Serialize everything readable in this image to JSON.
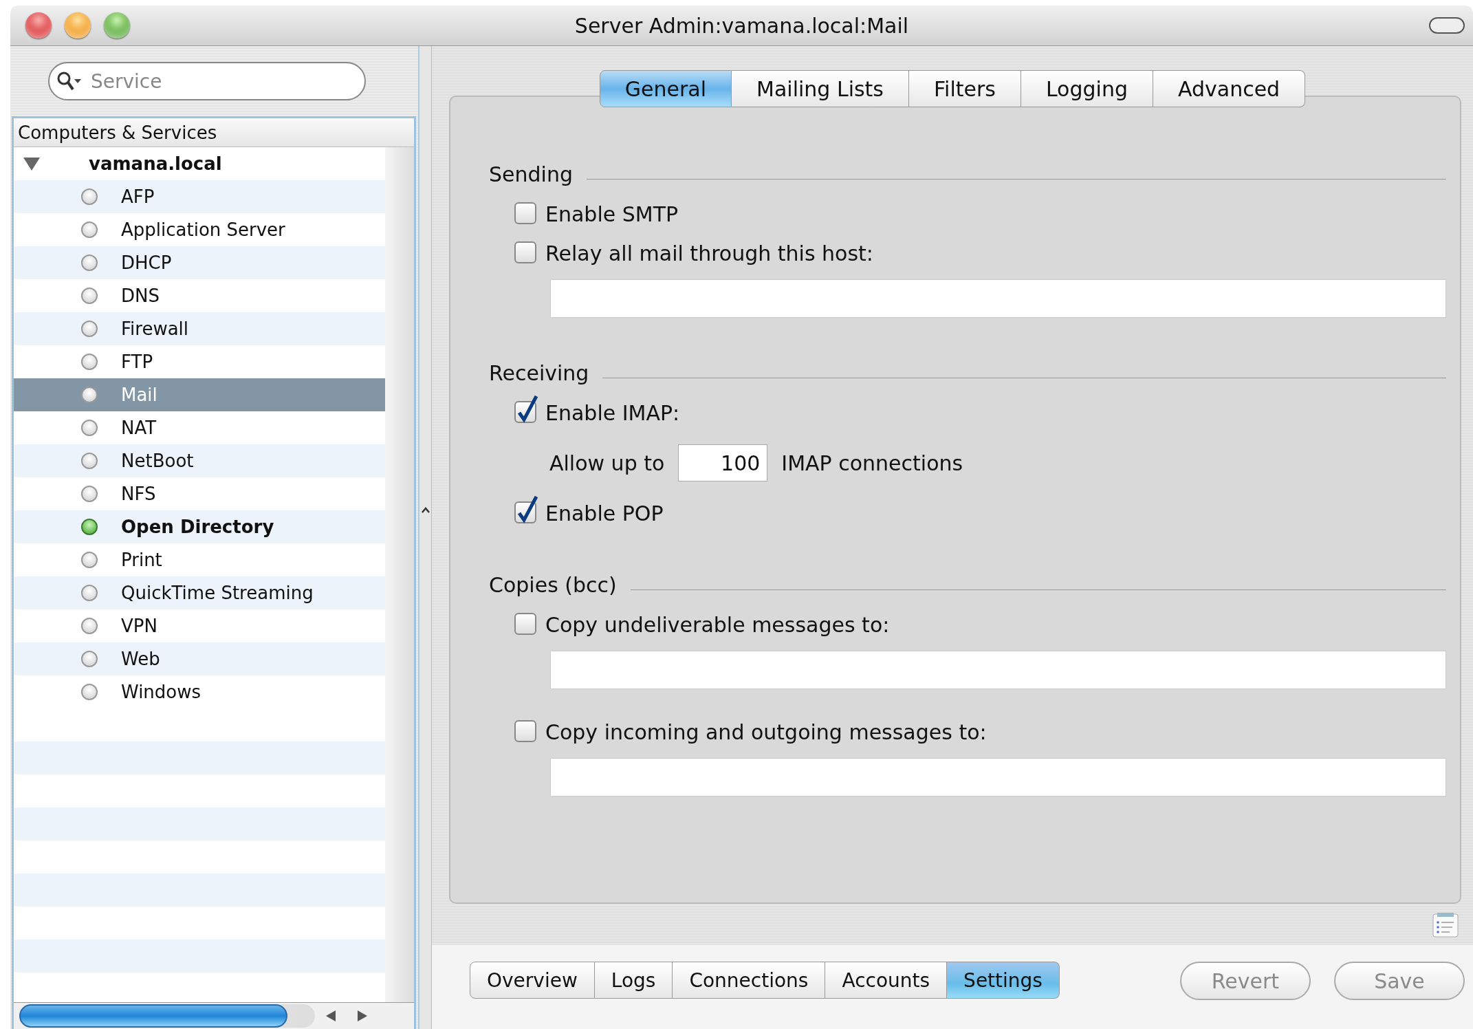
{
  "window": {
    "title": "Server Admin:vamana.local:Mail"
  },
  "search": {
    "placeholder": "Service"
  },
  "sidebar": {
    "header": "Computers & Services",
    "host": {
      "name": "vamana.local",
      "expanded": true
    },
    "services": [
      {
        "name": "AFP",
        "running": false,
        "selected": false
      },
      {
        "name": "Application Server",
        "running": false,
        "selected": false
      },
      {
        "name": "DHCP",
        "running": false,
        "selected": false
      },
      {
        "name": "DNS",
        "running": false,
        "selected": false
      },
      {
        "name": "Firewall",
        "running": false,
        "selected": false
      },
      {
        "name": "FTP",
        "running": false,
        "selected": false
      },
      {
        "name": "Mail",
        "running": false,
        "selected": true
      },
      {
        "name": "NAT",
        "running": false,
        "selected": false
      },
      {
        "name": "NetBoot",
        "running": false,
        "selected": false
      },
      {
        "name": "NFS",
        "running": false,
        "selected": false
      },
      {
        "name": "Open Directory",
        "running": true,
        "selected": false
      },
      {
        "name": "Print",
        "running": false,
        "selected": false
      },
      {
        "name": "QuickTime Streaming",
        "running": false,
        "selected": false
      },
      {
        "name": "VPN",
        "running": false,
        "selected": false
      },
      {
        "name": "Web",
        "running": false,
        "selected": false
      },
      {
        "name": "Windows",
        "running": false,
        "selected": false
      }
    ]
  },
  "tabs": [
    {
      "label": "General",
      "selected": true
    },
    {
      "label": "Mailing Lists",
      "selected": false
    },
    {
      "label": "Filters",
      "selected": false
    },
    {
      "label": "Logging",
      "selected": false
    },
    {
      "label": "Advanced",
      "selected": false
    }
  ],
  "sections": [
    {
      "title": "Sending",
      "items": [
        {
          "kind": "checkbox",
          "label": "Enable SMTP",
          "checked": false
        },
        {
          "kind": "checkbox",
          "label": "Relay all mail through this host:",
          "checked": false
        },
        {
          "kind": "field"
        }
      ]
    },
    {
      "title": "Receiving",
      "items": [
        {
          "kind": "checkbox",
          "label": "Enable IMAP:",
          "checked": true
        },
        {
          "kind": "limit",
          "prefix": "Allow up to",
          "value": "100",
          "suffix": "IMAP connections"
        },
        {
          "kind": "checkbox",
          "label": "Enable POP",
          "checked": true
        }
      ]
    },
    {
      "title": "Copies (bcc)",
      "items": [
        {
          "kind": "checkbox",
          "label": "Copy undeliverable messages to:",
          "checked": false
        },
        {
          "kind": "field"
        },
        {
          "kind": "checkbox",
          "label": "Copy incoming and outgoing messages to:",
          "checked": false
        },
        {
          "kind": "field"
        }
      ]
    }
  ],
  "bottom_tabs": [
    {
      "label": "Overview",
      "selected": false
    },
    {
      "label": "Logs",
      "selected": false
    },
    {
      "label": "Connections",
      "selected": false
    },
    {
      "label": "Accounts",
      "selected": false
    },
    {
      "label": "Settings",
      "selected": true
    }
  ],
  "buttons": [
    {
      "label": "Revert",
      "disabled": true
    },
    {
      "label": "Save",
      "disabled": true
    }
  ]
}
